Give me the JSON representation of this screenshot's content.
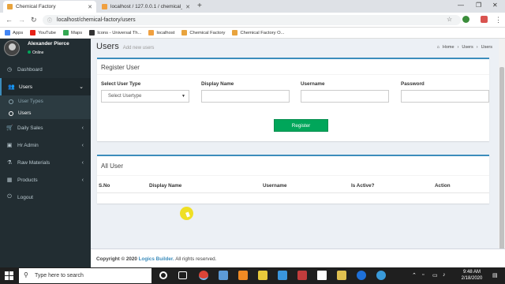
{
  "browser": {
    "tabs": [
      {
        "title": "Chemical Factory",
        "active": true
      },
      {
        "title": "localhost / 127.0.0.1 / chemical_",
        "active": false
      }
    ],
    "new_tab": "+",
    "url": "localhost/chemical-factory/users",
    "bookmarks": [
      "Apps",
      "YouTube",
      "Maps",
      "Icons - Universal Th...",
      "localhost",
      "Chemical Factory",
      "Chemical Factory O..."
    ]
  },
  "sidebar": {
    "user_name": "Alexander Pierce",
    "status": "Online",
    "items": [
      {
        "label": "Dashboard",
        "icon": "dashboard-icon"
      },
      {
        "label": "Users",
        "icon": "users-icon",
        "open": true
      },
      {
        "label": "User Types",
        "sub": true
      },
      {
        "label": "Users",
        "sub": true,
        "active": true
      },
      {
        "label": "Daily Sales",
        "icon": "cart-icon"
      },
      {
        "label": "Hr Admin",
        "icon": "briefcase-icon"
      },
      {
        "label": "Raw Materials",
        "icon": "flask-icon"
      },
      {
        "label": "Products",
        "icon": "box-icon"
      },
      {
        "label": "Logout",
        "icon": "power-icon"
      }
    ]
  },
  "page": {
    "title": "Users",
    "subtitle": "Add new users",
    "breadcrumb": [
      "Home",
      "Users",
      "Users"
    ]
  },
  "register": {
    "title": "Register User",
    "fields": [
      {
        "label": "Select User Type",
        "value": "Select Usertype"
      },
      {
        "label": "Display Name",
        "value": ""
      },
      {
        "label": "Username",
        "value": ""
      },
      {
        "label": "Password",
        "value": ""
      }
    ],
    "button": "Register"
  },
  "all_users": {
    "title": "All User",
    "columns": [
      "S.No",
      "Display Name",
      "Username",
      "Is Active?",
      "Action"
    ]
  },
  "footer": {
    "prefix": "Copyright © 2020",
    "brand": "Logics Builder.",
    "suffix": "All rights reserved."
  },
  "taskbar": {
    "search_placeholder": "Type here to search",
    "time": "9:48 AM",
    "date": "2/18/2020"
  },
  "colors": {
    "sidebar": "#222d32",
    "accent": "#3c8dbc",
    "register_button": "#00a65a"
  }
}
